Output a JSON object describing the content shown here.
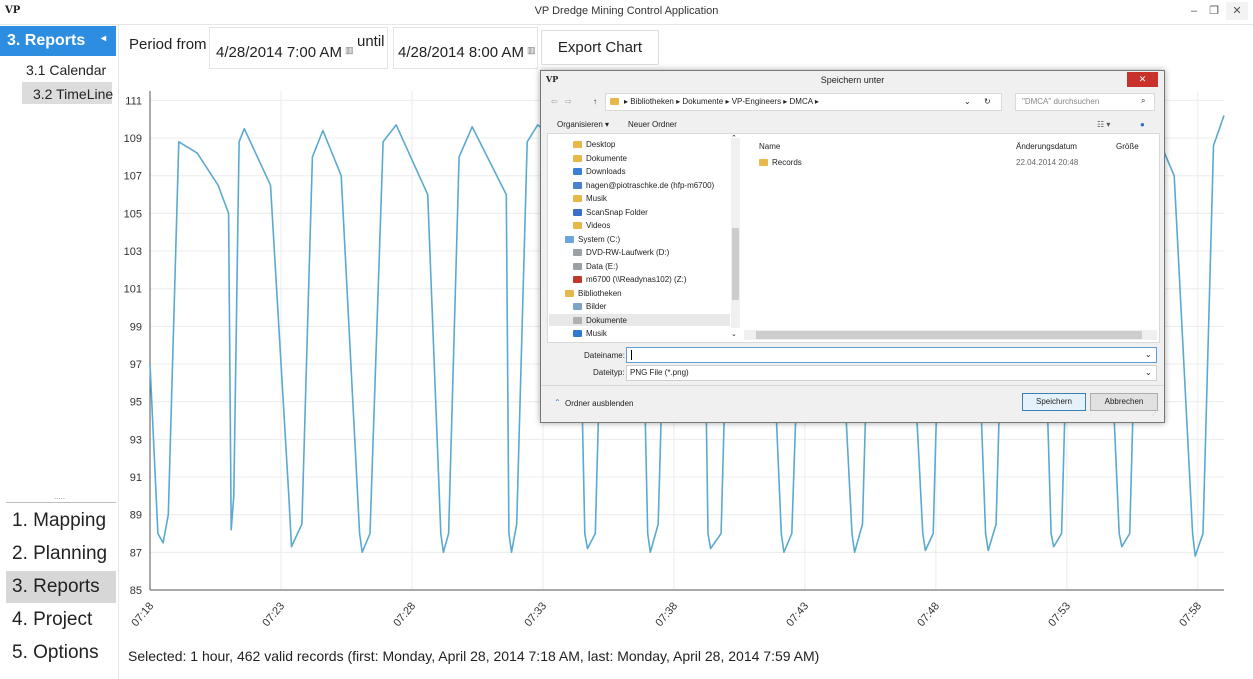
{
  "window": {
    "title": "VP Dredge Mining Control Application",
    "logo": "VP",
    "controls": {
      "minimize": "–",
      "maximize": "❐",
      "close": "✕"
    }
  },
  "nav": {
    "section_header": "3. Reports",
    "sub_items": [
      "3.1 Calendar",
      "3.2 TimeLine"
    ],
    "selected_sub_index": 1,
    "main_items": [
      "1. Mapping",
      "2. Planning",
      "3. Reports",
      "4. Project",
      "5. Options"
    ],
    "selected_main_index": 2,
    "accent_color": "#2d8de0"
  },
  "toolbar": {
    "period_from_label": "Period from",
    "from_value": "4/28/2014 7:00 AM",
    "until_label": "until",
    "until_value": "4/28/2014 8:00 AM",
    "export_label": "Export Chart"
  },
  "chart_data": {
    "type": "line",
    "title": "",
    "xlabel": "",
    "ylabel": "",
    "x_ticks": [
      "07:18",
      "07:23",
      "07:28",
      "07:33",
      "07:38",
      "07:43",
      "07:48",
      "07:53",
      "07:58"
    ],
    "y_ticks": [
      85,
      87,
      89,
      91,
      93,
      95,
      97,
      99,
      101,
      103,
      105,
      107,
      109,
      111
    ],
    "ylim": [
      85,
      111.5
    ],
    "xlim_minutes": [
      0,
      41
    ],
    "grid": true,
    "series": [
      {
        "color": "#5ba9d0",
        "x_minutes": [
          0.0,
          0.3,
          0.5,
          0.7,
          1.1,
          1.8,
          2.6,
          3.0,
          3.1,
          3.2,
          3.4,
          3.6,
          4.6,
          5.3,
          5.4,
          5.8,
          6.2,
          6.6,
          7.3,
          8.0,
          8.1,
          8.4,
          8.9,
          9.4,
          10.6,
          11.1,
          11.2,
          11.4,
          11.8,
          12.3,
          13.6,
          13.7,
          13.8,
          14.0,
          14.4,
          14.8,
          16.3,
          16.6,
          16.7,
          17.0,
          17.4,
          17.9,
          18.7,
          19.0,
          19.1,
          19.4,
          19.8,
          20.3,
          21.1,
          21.3,
          21.4,
          21.8,
          22.2,
          22.7,
          23.5,
          24.1,
          24.2,
          24.5,
          25.0,
          25.4,
          26.1,
          26.8,
          26.9,
          27.2,
          27.6,
          28.0,
          28.8,
          29.5,
          29.6,
          29.9,
          30.3,
          30.7,
          31.4,
          31.9,
          32.0,
          32.3,
          32.7,
          33.2,
          34.0,
          34.4,
          34.5,
          34.8,
          35.2,
          35.6,
          36.4,
          37.0,
          37.1,
          37.4,
          37.8,
          38.3,
          39.1,
          39.8,
          39.9,
          40.2,
          40.6,
          41.0
        ],
        "values": [
          97.0,
          88.0,
          87.5,
          89.0,
          108.8,
          108.2,
          106.5,
          105.0,
          88.2,
          90.0,
          108.8,
          109.5,
          106.5,
          90.0,
          87.3,
          88.5,
          108.0,
          109.4,
          107.0,
          88.0,
          87.0,
          88.0,
          108.8,
          109.7,
          106.0,
          88.0,
          87.0,
          88.0,
          108.0,
          109.6,
          106.0,
          88.0,
          87.0,
          88.5,
          108.8,
          109.7,
          108.0,
          88.0,
          87.2,
          88.0,
          108.8,
          109.6,
          107.5,
          88.0,
          87.0,
          88.5,
          108.5,
          109.6,
          107.5,
          88.0,
          87.2,
          88.0,
          108.6,
          109.6,
          107.5,
          88.0,
          87.0,
          88.0,
          108.6,
          109.6,
          107.0,
          88.0,
          87.0,
          88.5,
          108.6,
          109.6,
          107.0,
          88.0,
          87.1,
          88.0,
          108.6,
          109.6,
          107.0,
          88.0,
          87.1,
          88.5,
          108.6,
          109.6,
          107.0,
          88.0,
          87.3,
          88.0,
          108.6,
          109.6,
          107.0,
          88.0,
          87.3,
          88.0,
          108.6,
          109.6,
          107.0,
          88.0,
          86.8,
          88.0,
          108.6,
          110.2
        ]
      }
    ]
  },
  "status": {
    "text": "Selected: 1 hour, 462 valid records (first: Monday, April 28, 2014 7:18 AM, last: Monday, April 28, 2014 7:59 AM)"
  },
  "dialog": {
    "title": "Speichern unter",
    "logo": "VP",
    "close": "✕",
    "breadcrumb": [
      "Bibliotheken",
      "Dokumente",
      "VP-Engineers",
      "DMCA"
    ],
    "search_placeholder": "\"DMCA\" durchsuchen",
    "organize_label": "Organisieren ▾",
    "new_folder_label": "Neuer Ordner",
    "tree_items": [
      {
        "label": "Desktop",
        "icon": "folder-icon",
        "color": "#e8b84a"
      },
      {
        "label": "Dokumente",
        "icon": "folder-icon",
        "color": "#e8b84a"
      },
      {
        "label": "Downloads",
        "icon": "folder-icon",
        "color": "#3b7fd6"
      },
      {
        "label": "hagen@piotraschke.de (hfp-m6700)",
        "icon": "user-icon",
        "color": "#4a7fd1"
      },
      {
        "label": "Musik",
        "icon": "music-folder-icon",
        "color": "#e8b84a"
      },
      {
        "label": "ScanSnap Folder",
        "icon": "scanner-icon",
        "color": "#3a6fc9"
      },
      {
        "label": "Videos",
        "icon": "folder-icon",
        "color": "#e8b84a"
      },
      {
        "label": "System (C:)",
        "icon": "drive-icon",
        "color": "#6aa6dd"
      },
      {
        "label": "DVD-RW-Laufwerk (D:)",
        "icon": "dvd-icon",
        "color": "#9aa0a6"
      },
      {
        "label": "Data (E:)",
        "icon": "drive-icon",
        "color": "#9aa0a6"
      },
      {
        "label": "m6700 (\\\\Readynas102) (Z:)",
        "icon": "network-drive-icon",
        "color": "#c0392b"
      },
      {
        "label": "Bibliotheken",
        "icon": "library-icon",
        "color": "#e8b84a"
      },
      {
        "label": "Bilder",
        "icon": "picture-icon",
        "color": "#7ea3c8"
      },
      {
        "label": "Dokumente",
        "icon": "document-icon",
        "color": "#b0b0b0"
      },
      {
        "label": "Musik",
        "icon": "music-icon",
        "color": "#2f7bd0"
      }
    ],
    "selected_tree_index": 13,
    "columns": {
      "name": "Name",
      "date": "Änderungsdatum",
      "size": "Größe"
    },
    "files": [
      {
        "name": "Records",
        "date": "22.04.2014 20:48",
        "size": ""
      }
    ],
    "filename_label": "Dateiname:",
    "filename_value": "",
    "filetype_label": "Dateityp:",
    "filetype_value": "PNG File (*.png)",
    "hide_folders_label": "Ordner ausblenden",
    "save_label": "Speichern",
    "cancel_label": "Abbrechen"
  }
}
